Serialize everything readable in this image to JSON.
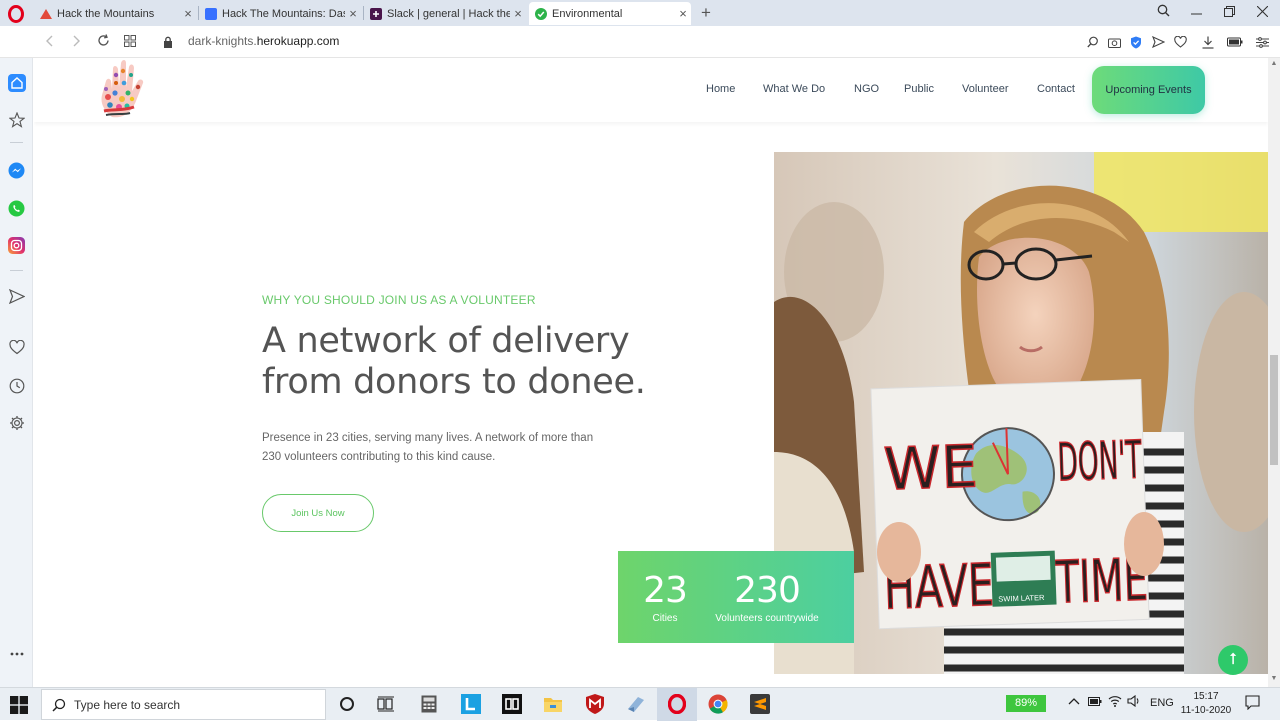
{
  "browser": {
    "tabs": [
      {
        "title": "Hack the Mountains",
        "active": false
      },
      {
        "title": "Hack The Mountains: Dash",
        "active": false
      },
      {
        "title": "Slack | general | Hack the M",
        "active": false
      },
      {
        "title": "Environmental",
        "active": true
      }
    ],
    "close_symbol": "×",
    "new_tab_symbol": "+",
    "url_prefix": "dark-knights.",
    "url_domain": "herokuapp.com"
  },
  "site": {
    "nav": [
      "Home",
      "What We Do",
      "NGO",
      "Public",
      "Volunteer",
      "Contact"
    ],
    "cta_label": "Upcoming Events",
    "eyebrow": "WHY YOU SHOULD JOIN US AS A VOLUNTEER",
    "headline": "A network of delivery from donors to donee.",
    "lead": "Presence in 23 cities, serving many lives. A network of more than 230 volunteers contributing to this kind cause.",
    "join_button": "Join Us Now",
    "stats": [
      {
        "value": "23",
        "label": "Cities"
      },
      {
        "value": "230",
        "label": "Volunteers countrywide"
      }
    ],
    "scroll_top_symbol": "⭡",
    "photo_sign": {
      "line1_left": "WE",
      "line1_right": "DON'T",
      "line2_left": "HAVE",
      "line2_right": "TIME",
      "sticker": "SWIM LATER"
    }
  },
  "taskbar": {
    "search_placeholder": "Type here to search",
    "battery": "89%",
    "language": "ENG",
    "time": "15:17",
    "date": "11-10-2020"
  },
  "colors": {
    "accent_green": "#69c96b",
    "gradient_start": "#6ed46b",
    "gradient_end": "#4ccfa0",
    "opera_red": "#e3001b"
  }
}
